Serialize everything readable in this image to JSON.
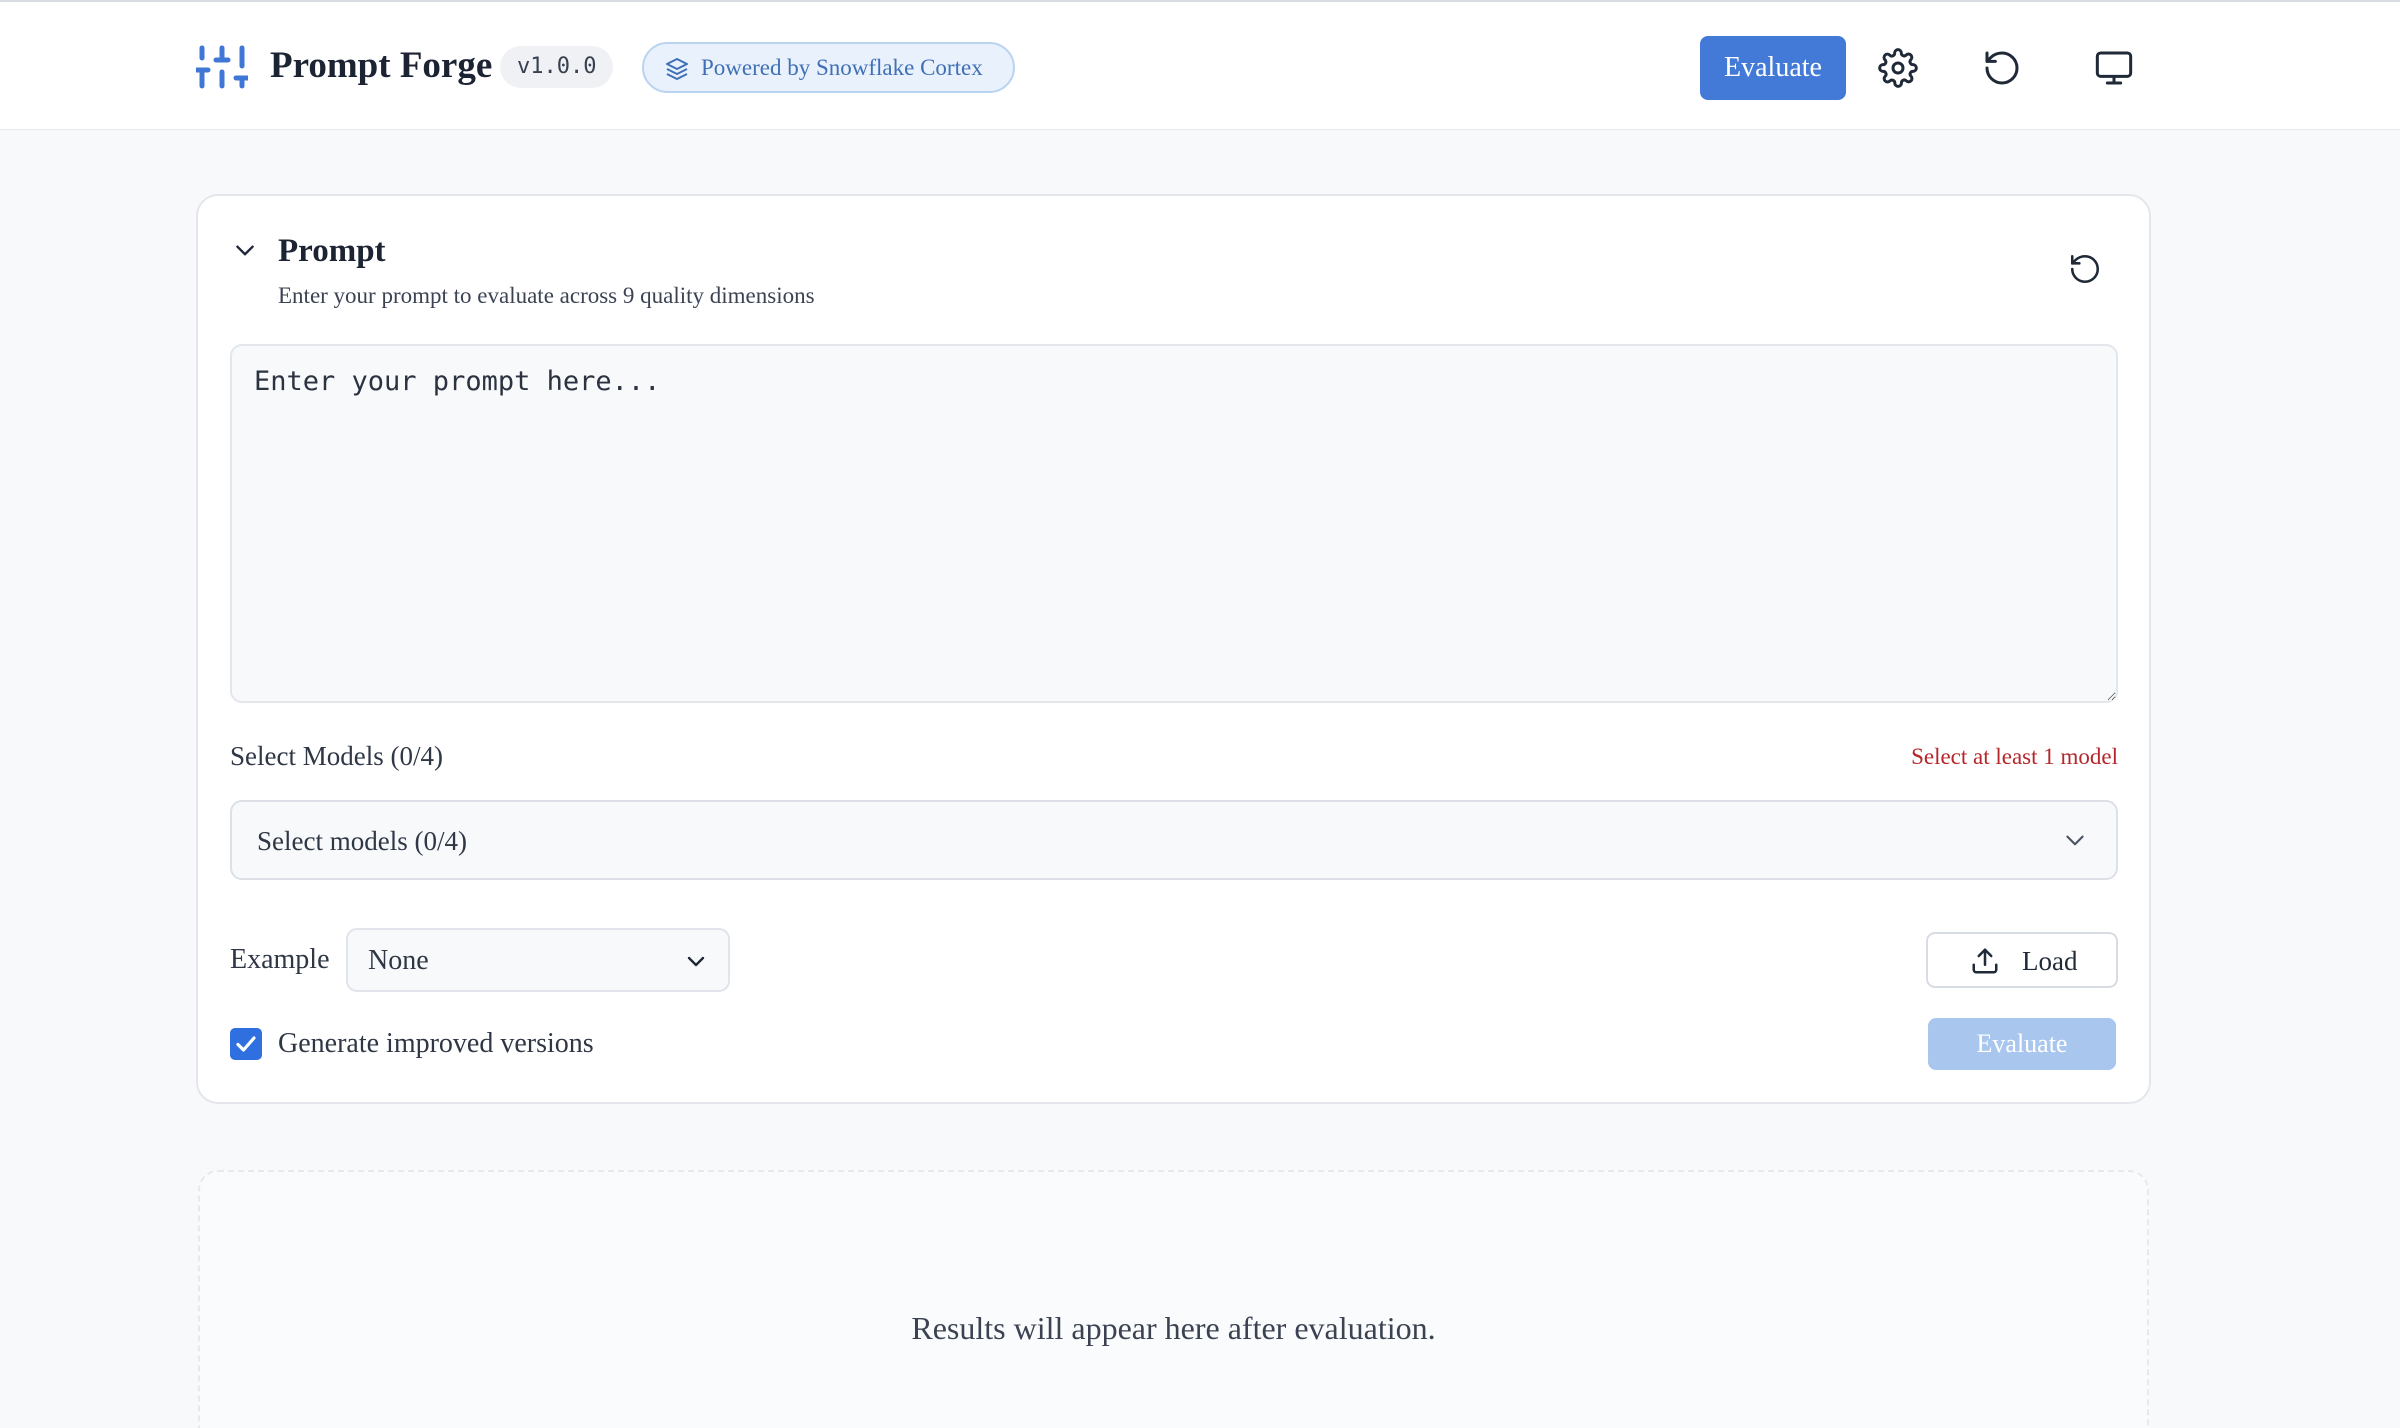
{
  "header": {
    "title": "Prompt Forge",
    "version": "v1.0.0",
    "powered_by": "Powered by Snowflake Cortex",
    "evaluate_label": "Evaluate",
    "icons": [
      "sliders-icon",
      "gear-icon",
      "refresh-icon",
      "monitor-icon"
    ]
  },
  "prompt_card": {
    "title": "Prompt",
    "subtitle": "Enter your prompt to evaluate across 9 quality dimensions",
    "textarea_value": "",
    "textarea_placeholder": "Enter your prompt here...",
    "models_label": "Select Models (0/4)",
    "models_error": "Select at least 1 model",
    "models_select_value": "Select models (0/4)",
    "example_label": "Example",
    "example_value": "None",
    "load_label": "Load",
    "improve_checkbox_label": "Generate improved versions",
    "improve_checked": true,
    "evaluate_label": "Evaluate"
  },
  "results": {
    "placeholder": "Results will appear here after evaluation."
  },
  "colors": {
    "accent": "#437ad8",
    "accent_disabled": "#a9c6ee",
    "error": "#b4262a",
    "badge_bg": "#e9f1fc",
    "badge_text": "#3f6fb6"
  }
}
